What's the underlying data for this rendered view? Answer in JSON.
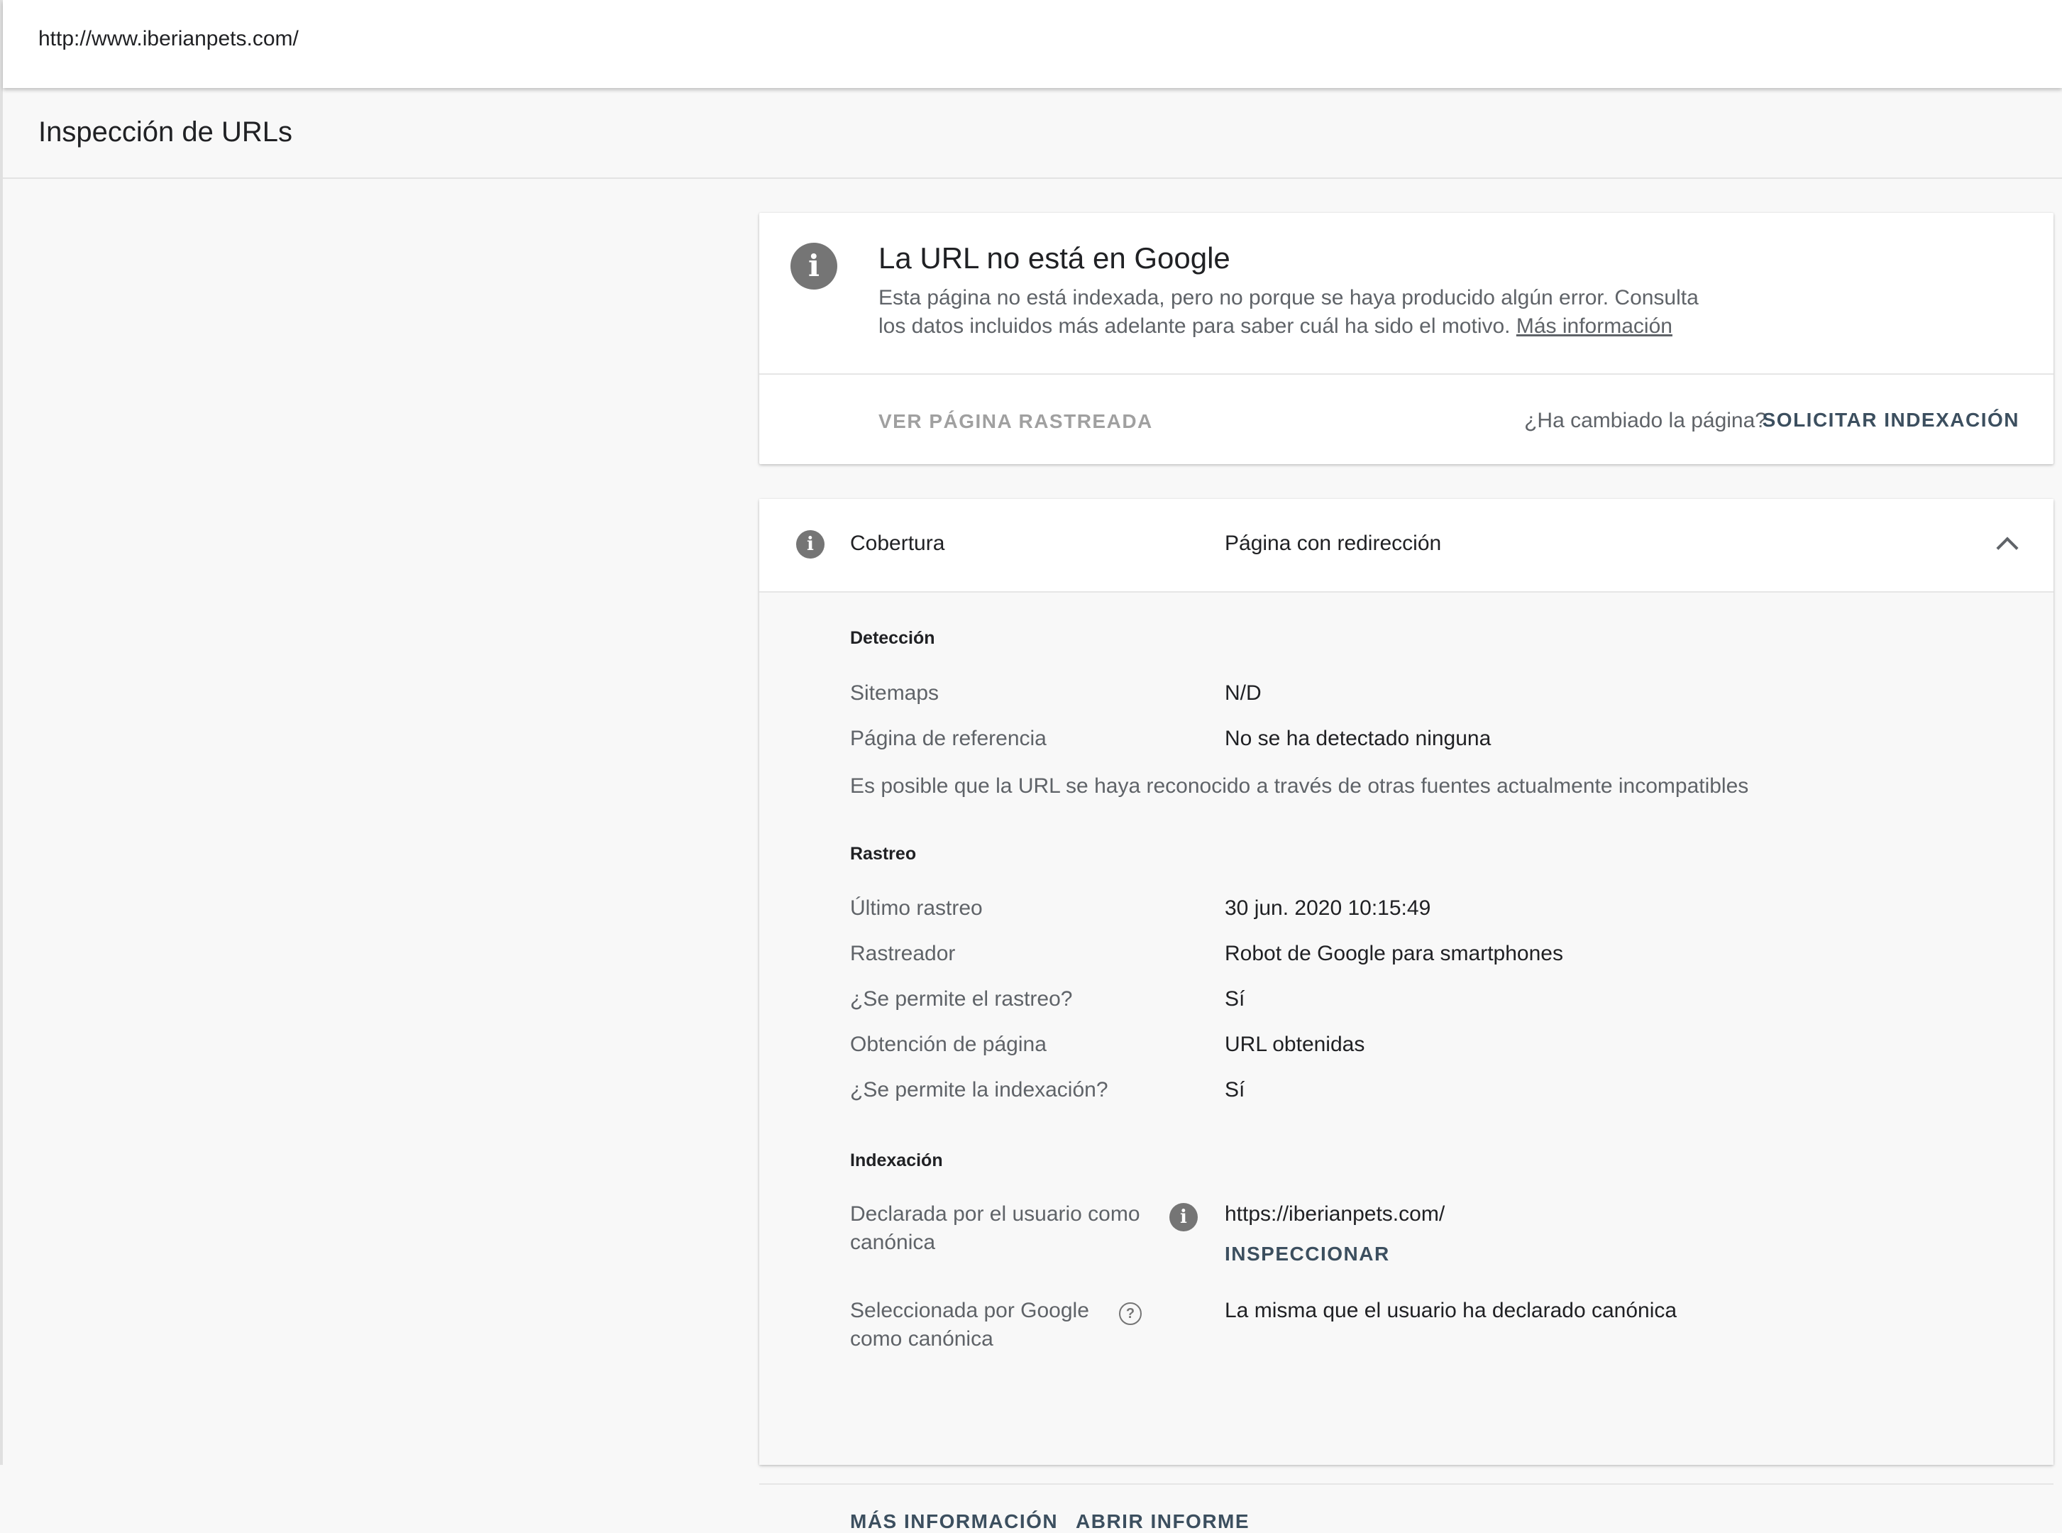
{
  "urlbar": {
    "url": "http://www.iberianpets.com/"
  },
  "header": {
    "title": "Inspección de URLs"
  },
  "status_card": {
    "icon": "info-icon",
    "title": "La URL no está en Google",
    "description": "Esta página no está indexada, pero no porque se haya producido algún error. Consulta los datos incluidos más adelante para saber cuál ha sido el motivo.",
    "more_info_link": "Más información",
    "view_crawled_label": "VER PÁGINA RASTREADA",
    "changed_question": "¿Ha cambiado la página?",
    "request_indexing_label": "SOLICITAR INDEXACIÓN"
  },
  "coverage": {
    "label": "Cobertura",
    "value": "Página con redirección",
    "detection": {
      "heading": "Detección",
      "sitemaps_label": "Sitemaps",
      "sitemaps_value": "N/D",
      "referring_label": "Página de referencia",
      "referring_value": "No se ha detectado ninguna",
      "note": "Es posible que la URL se haya reconocido a través de otras fuentes actualmente incompatibles"
    },
    "crawl": {
      "heading": "Rastreo",
      "rows": [
        {
          "label": "Último rastreo",
          "value": "30 jun. 2020 10:15:49"
        },
        {
          "label": "Rastreador",
          "value": "Robot de Google para smartphones"
        },
        {
          "label": "¿Se permite el rastreo?",
          "value": "Sí"
        },
        {
          "label": "Obtención de página",
          "value": "URL obtenidas"
        },
        {
          "label": "¿Se permite la indexación?",
          "value": "Sí"
        }
      ]
    },
    "indexing": {
      "heading": "Indexación",
      "user_canonical_label_1": "Declarada por el usuario como",
      "user_canonical_label_2": "canónica",
      "user_canonical_value": "https://iberianpets.com/",
      "inspect_label": "INSPECCIONAR",
      "google_canonical_label_1": "Seleccionada por Google",
      "google_canonical_label_2": "como canónica",
      "google_canonical_value": "La misma que el usuario ha declarado canónica"
    },
    "footer": {
      "more_info_label": "MÁS INFORMACIÓN",
      "open_report_label": "ABRIR INFORME"
    }
  }
}
